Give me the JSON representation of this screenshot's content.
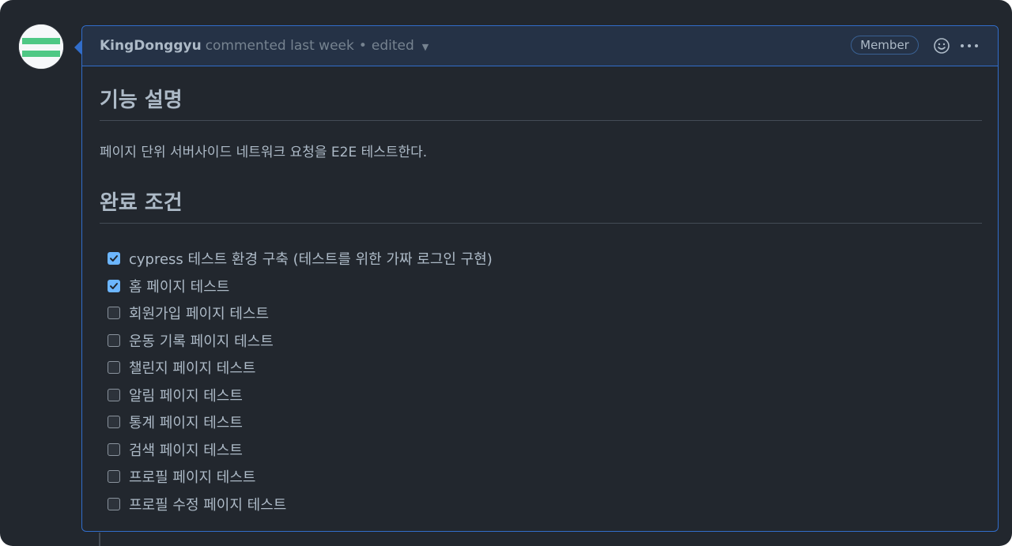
{
  "comment": {
    "author": "KingDonggyu",
    "meta": "commented last week",
    "separator": "•",
    "edited": "edited",
    "badge": "Member",
    "accent_color": "#316dca"
  },
  "body": {
    "heading_feature": "기능 설명",
    "description": "페이지 단위 서버사이드 네트워크 요청을 E2E 테스트한다.",
    "heading_done": "완료 조건",
    "tasks": [
      {
        "label": "cypress 테스트 환경 구축 (테스트를 위한 가짜 로그인 구현)",
        "checked": true
      },
      {
        "label": "홈 페이지 테스트",
        "checked": true
      },
      {
        "label": "회원가입 페이지 테스트",
        "checked": false
      },
      {
        "label": "운동 기록 페이지 테스트",
        "checked": false
      },
      {
        "label": "챌린지 페이지 테스트",
        "checked": false
      },
      {
        "label": "알림 페이지 테스트",
        "checked": false
      },
      {
        "label": "통계 페이지 테스트",
        "checked": false
      },
      {
        "label": "검색 페이지 테스트",
        "checked": false
      },
      {
        "label": "프로필 페이지 테스트",
        "checked": false
      },
      {
        "label": "프로필 수정 페이지 테스트",
        "checked": false
      }
    ]
  },
  "icons": {
    "avatar": "identicon-avatar",
    "reaction": "smiley-icon",
    "more": "kebab-horizontal-icon",
    "edited_menu": "chevron-down-icon",
    "checked": "checkbox-checked-icon",
    "unchecked": "checkbox-empty-icon"
  }
}
